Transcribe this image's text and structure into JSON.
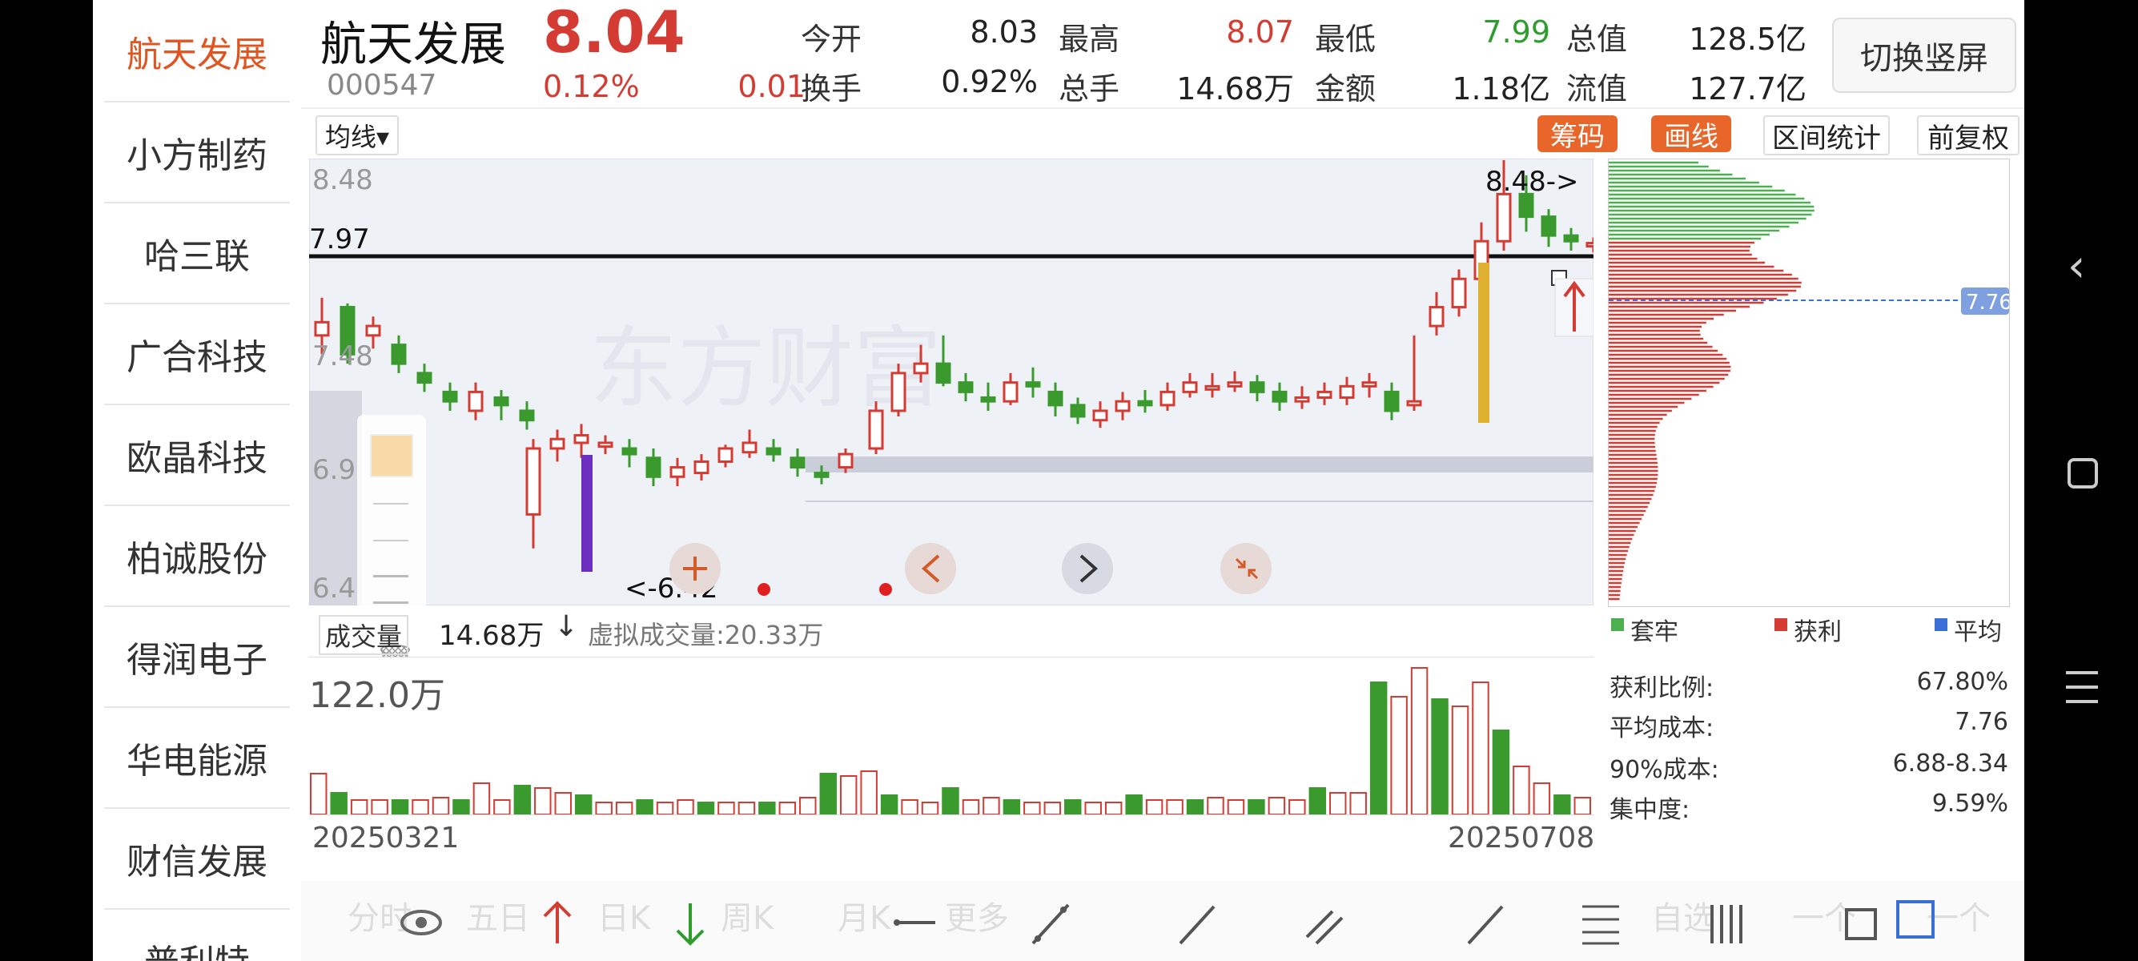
{
  "sidebar": {
    "items": [
      {
        "label": "航天发展",
        "active": true
      },
      {
        "label": "小方制药"
      },
      {
        "label": "哈三联"
      },
      {
        "label": "广合科技"
      },
      {
        "label": "欧晶科技"
      },
      {
        "label": "柏诚股份"
      },
      {
        "label": "得润电子"
      },
      {
        "label": "华电能源"
      },
      {
        "label": "财信发展"
      },
      {
        "label": "普利特"
      }
    ]
  },
  "header": {
    "name": "航天发展",
    "price": "8.04",
    "code": "000547",
    "change_pct": "0.12%",
    "change_abs": "0.01",
    "stats": [
      {
        "label": "今开",
        "value": "8.03"
      },
      {
        "label": "最高",
        "value": "8.07"
      },
      {
        "label": "最低",
        "value": "7.99"
      },
      {
        "label": "总值",
        "value": "128.5亿"
      },
      {
        "label": "换手",
        "value": "0.92%"
      },
      {
        "label": "总手",
        "value": "14.68万"
      },
      {
        "label": "金额",
        "value": "1.18亿"
      },
      {
        "label": "流值",
        "value": "127.7亿"
      }
    ],
    "switch_button": "切换竖屏"
  },
  "toolbar": {
    "ma_select": "均线▾",
    "chips": "筹码",
    "draw": "画线",
    "range_stats": "区间统计",
    "adjust": "前复权"
  },
  "kchart": {
    "y_labels": [
      "8.48",
      "7.97",
      "7.48",
      "6.9",
      "6.4"
    ],
    "hline_label": "7.97",
    "high_marker": "8.48->",
    "low_marker": "<-6.42",
    "avg_cost_tag": "7.76"
  },
  "volume": {
    "label": "成交量",
    "value": "14.68万",
    "arrow": "↓",
    "virtual": "虚拟成交量:20.33万",
    "max_label": "122.0万",
    "start_date": "20250321",
    "end_date": "20250708"
  },
  "chips_legend": [
    {
      "label": "套牢",
      "color": "#4caf50"
    },
    {
      "label": "获利",
      "color": "#d43c33"
    },
    {
      "label": "平均",
      "color": "#3b6fd8"
    }
  ],
  "chips_info": [
    {
      "label": "获利比例:",
      "value": "67.80%"
    },
    {
      "label": "平均成本:",
      "value": "7.76"
    },
    {
      "label": "90%成本:",
      "value": "6.88-8.34"
    },
    {
      "label": "集中度:",
      "value": "9.59%"
    }
  ],
  "bottom_tabs": [
    "分时",
    "五日",
    "日K",
    "周K",
    "月K",
    "更多",
    "自选",
    "一个",
    "一个"
  ],
  "colors": {
    "up": "#d43c33",
    "down": "#3a9a2e",
    "accent": "#e8662a"
  }
}
